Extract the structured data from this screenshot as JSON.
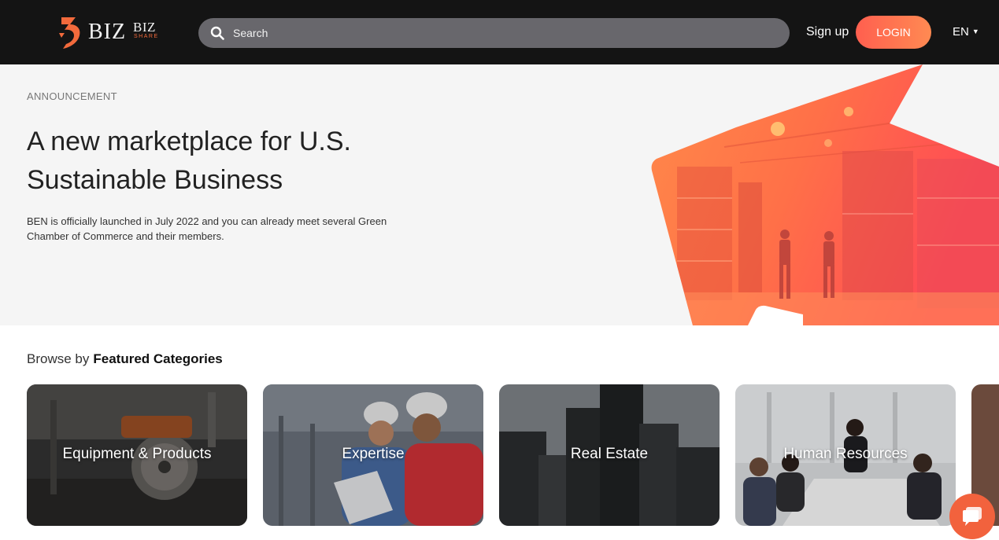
{
  "header": {
    "logo_text": "BIZ",
    "logo_text_small": "BIZ",
    "logo_tagline": "SHARE",
    "search_placeholder": "Search",
    "signup_label": "Sign up",
    "login_label": "LOGIN",
    "language": "EN"
  },
  "hero": {
    "kicker": "ANNOUNCEMENT",
    "title": "A new marketplace for U.S. Sustainable Business",
    "description": "BEN is officially launched in July 2022 and you can already meet several Green Chamber of Commerce and their members."
  },
  "categories": {
    "prefix": "Browse by",
    "heading": "Featured Categories",
    "items": [
      {
        "label": "Equipment & Products"
      },
      {
        "label": "Expertise"
      },
      {
        "label": "Real Estate"
      },
      {
        "label": "Human Resources"
      }
    ]
  },
  "colors": {
    "header_bg": "#141414",
    "accent": "#ff6a4d",
    "hero_bg": "#f5f5f5",
    "search_bg": "#68676c"
  },
  "icons": {
    "search": "search-icon",
    "chat": "chat-icon",
    "language_caret": "caret-down-icon"
  }
}
